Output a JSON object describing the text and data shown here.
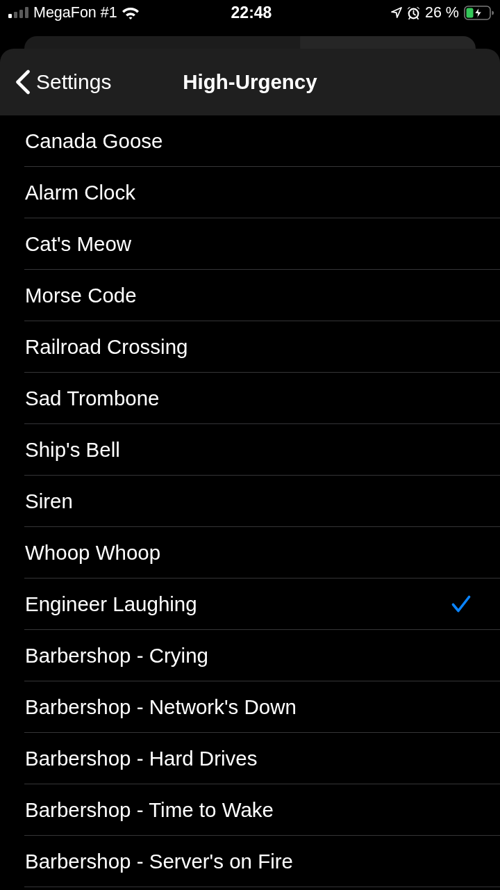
{
  "status_bar": {
    "carrier": "MegaFon #1",
    "time": "22:48",
    "battery_percent": "26 %"
  },
  "nav": {
    "back_label": "Settings",
    "title": "High-Urgency"
  },
  "sounds": [
    {
      "name": "Canada Goose",
      "selected": false
    },
    {
      "name": "Alarm Clock",
      "selected": false
    },
    {
      "name": "Cat's Meow",
      "selected": false
    },
    {
      "name": "Morse Code",
      "selected": false
    },
    {
      "name": "Railroad Crossing",
      "selected": false
    },
    {
      "name": "Sad Trombone",
      "selected": false
    },
    {
      "name": "Ship's Bell",
      "selected": false
    },
    {
      "name": "Siren",
      "selected": false
    },
    {
      "name": "Whoop Whoop",
      "selected": false
    },
    {
      "name": "Engineer Laughing",
      "selected": true
    },
    {
      "name": "Barbershop - Crying",
      "selected": false
    },
    {
      "name": "Barbershop - Network's Down",
      "selected": false
    },
    {
      "name": "Barbershop - Hard Drives",
      "selected": false
    },
    {
      "name": "Barbershop - Time to Wake",
      "selected": false
    },
    {
      "name": "Barbershop - Server's on Fire",
      "selected": false
    }
  ]
}
